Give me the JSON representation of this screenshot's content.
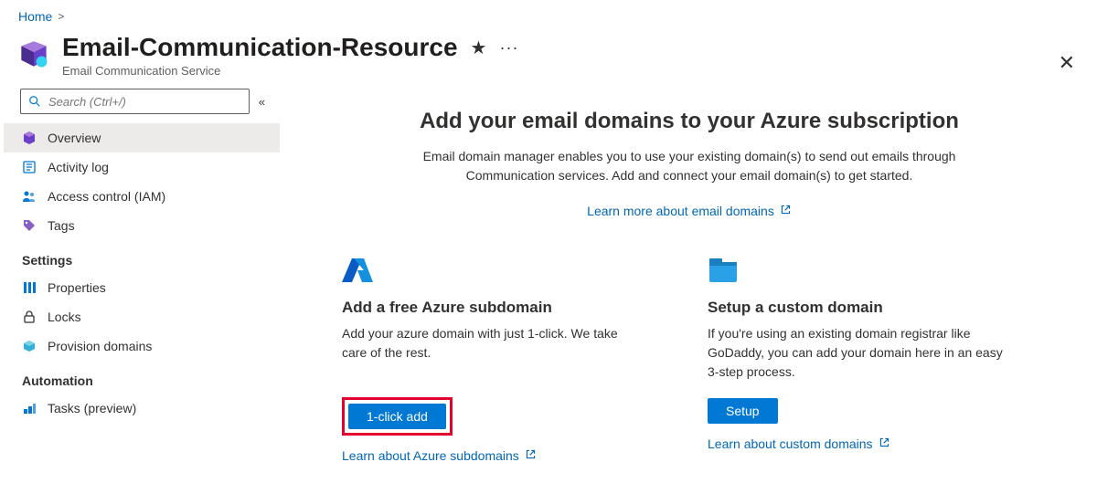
{
  "breadcrumb": {
    "home": "Home"
  },
  "header": {
    "title": "Email-Communication-Resource",
    "subtitle": "Email Communication Service"
  },
  "sidebar": {
    "search_placeholder": "Search (Ctrl+/)",
    "items": [
      {
        "label": "Overview"
      },
      {
        "label": "Activity log"
      },
      {
        "label": "Access control (IAM)"
      },
      {
        "label": "Tags"
      }
    ],
    "settings_heading": "Settings",
    "settings_items": [
      {
        "label": "Properties"
      },
      {
        "label": "Locks"
      },
      {
        "label": "Provision domains"
      }
    ],
    "automation_heading": "Automation",
    "automation_items": [
      {
        "label": "Tasks (preview)"
      }
    ]
  },
  "main": {
    "hero_title": "Add your email domains to your Azure subscription",
    "hero_desc": "Email domain manager enables you to use your existing domain(s) to send out emails through Communication services. Add and connect your email domain(s) to get started.",
    "hero_link": "Learn more about email domains",
    "cards": [
      {
        "title": "Add a free Azure subdomain",
        "desc": "Add your azure domain with just 1-click. We take care of the rest.",
        "button": "1-click add",
        "link": "Learn about Azure subdomains"
      },
      {
        "title": "Setup a custom domain",
        "desc": "If you're using an existing domain registrar like GoDaddy, you can add your domain here in an easy 3-step process.",
        "button": "Setup",
        "link": "Learn about custom domains"
      }
    ]
  }
}
